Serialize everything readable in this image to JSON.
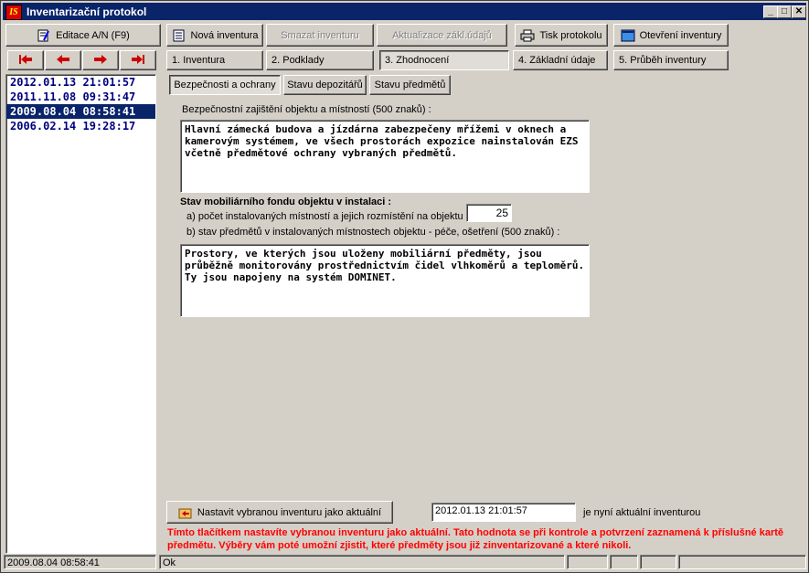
{
  "window": {
    "title": "Inventarizační protokol",
    "app_icon": "IS",
    "btn_min": "_",
    "btn_max": "□",
    "btn_close": "✕"
  },
  "toolbar": {
    "edit": "Editace A/N (F9)",
    "new": "Nová inventura",
    "delete": "Smazat inventuru",
    "update": "Aktualizace zákl.údajů",
    "print": "Tisk protokolu",
    "open": "Otevření inventury"
  },
  "tabs": [
    "1. Inventura",
    "2. Podklady",
    "3. Zhodnocení",
    "4. Základní údaje",
    "5. Průběh inventury"
  ],
  "subtabs": [
    "Bezpečnosti a ochrany",
    "Stavu depozitářů",
    "Stavu předmětů"
  ],
  "list": [
    "2012.01.13 21:01:57",
    "2011.11.08 09:31:47",
    "2009.08.04 08:58:41",
    "2006.02.14 19:28:17"
  ],
  "selected_index": 2,
  "security": {
    "label": "Bezpečnostní zajištění objektu a místností (500 znaků) :",
    "text": "Hlavní zámecká budova a jízdárna zabezpečeny mřížemi v oknech a kamerovým systémem, ve všech prostorách expozice nainstalován EZS včetně předmětové ochrany vybraných předmětů."
  },
  "furniture": {
    "heading": "Stav mobiliárního fondu objektu v instalaci :",
    "rooms_label": "a) počet instalovaných místností a jejich rozmístění na objektu :",
    "rooms_value": "25",
    "state_label": "b) stav předmětů v instalovaných místnostech objektu - péče, ošetření (500 znaků) :",
    "state_text": "Prostory, ve kterých jsou uloženy mobiliární předměty, jsou průběžně monitorovány prostřednictvím čidel vlhkoměrů a teploměrů. Ty jsou napojeny na systém DOMINET."
  },
  "current": {
    "button": "Nastavit vybranou inventuru jako aktuální",
    "value": "2012.01.13 21:01:57",
    "suffix": "je nyní aktuální inventurou",
    "warning": "Tímto tlačítkem nastavíte vybranou inventuru jako aktuální. Tato hodnota se při kontrole a potvrzení zaznamená k příslušné kartě předmětu. Výběry vám poté umožní zjistit, které předměty jsou již zinventarizované a které nikoli."
  },
  "statusbar": {
    "left": "2009.08.04 08:58:41",
    "middle": "Ok"
  },
  "colors": {
    "title_bar": "#0a246a",
    "list_text": "#000080",
    "warning": "#ff0000",
    "nav_arrow": "#cc0000"
  }
}
